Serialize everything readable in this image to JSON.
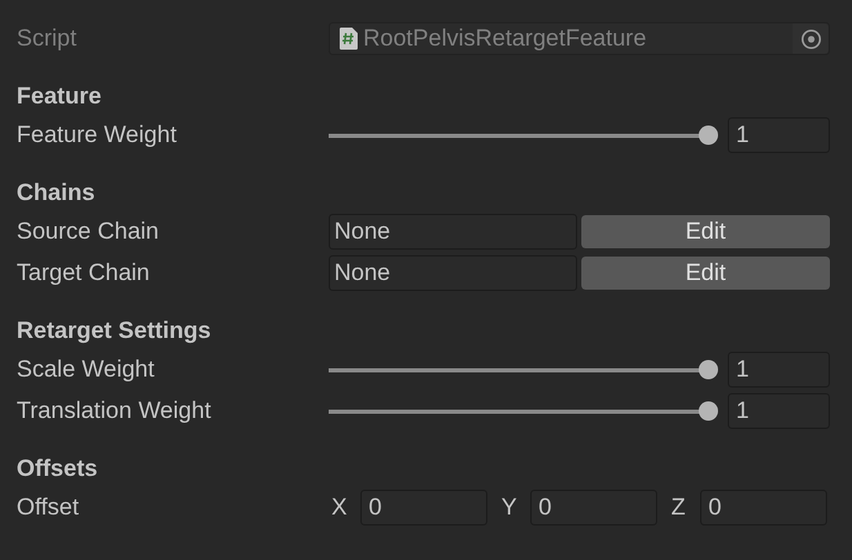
{
  "script": {
    "label": "Script",
    "value": "RootPelvisRetargetFeature",
    "disabled": true
  },
  "sections": [
    {
      "title": "Feature",
      "rows": [
        {
          "kind": "slider",
          "label": "Feature Weight",
          "level": 1,
          "value": "1"
        }
      ]
    },
    {
      "title": "Chains",
      "rows": [
        {
          "kind": "object",
          "label": "Source Chain",
          "value": "None",
          "button": "Edit"
        },
        {
          "kind": "object",
          "label": "Target Chain",
          "value": "None",
          "button": "Edit"
        }
      ]
    },
    {
      "title": "Retarget Settings",
      "rows": [
        {
          "kind": "slider",
          "label": "Scale Weight",
          "level": 1,
          "value": "1"
        },
        {
          "kind": "slider",
          "label": "Translation Weight",
          "level": 1,
          "value": "1"
        }
      ]
    },
    {
      "title": "Offsets",
      "rows": [
        {
          "kind": "vector",
          "label": "Offset",
          "components": [
            {
              "axis": "X",
              "value": "0"
            },
            {
              "axis": "Y",
              "value": "0"
            },
            {
              "axis": "Z",
              "value": "0"
            }
          ]
        }
      ]
    }
  ]
}
